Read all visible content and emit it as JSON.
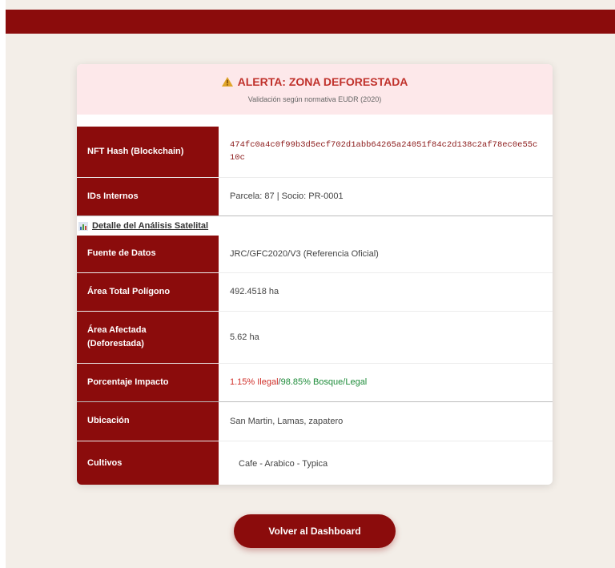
{
  "alert": {
    "title": "ALERTA: ZONA DEFORESTADA",
    "subtitle": "Validación según normativa EUDR (2020)"
  },
  "nft": {
    "label": "NFT Hash (Blockchain)",
    "value": "474fc0a4c0f99b3d5ecf702d1abb64265a24051f84c2d138c2af78ec0e55c10c"
  },
  "internal": {
    "label": "IDs Internos",
    "value": "Parcela: 87 | Socio: PR-0001"
  },
  "section": {
    "title": "Detalle del Análisis Satelital"
  },
  "details": {
    "source": {
      "label": "Fuente de Datos",
      "value": "JRC/GFC2020/V3 (Referencia Oficial)"
    },
    "area_total": {
      "label": "Área Total Polígono",
      "value": "492.4518 ha"
    },
    "area_affected": {
      "label_line1": "Área Afectada",
      "label_line2": "(Deforestada)",
      "value": "5.62 ha"
    },
    "impact": {
      "label": "Porcentaje Impacto",
      "illegal": "1.15% Ilegal",
      "legal": "98.85% Bosque/Legal",
      "separator": "/"
    },
    "location": {
      "label": "Ubicación",
      "value": "San Martin, Lamas, zapatero"
    },
    "crops": {
      "label": "Cultivos",
      "value": "Cafe - Arabico - Typica"
    }
  },
  "button": {
    "label": "Volver al Dashboard"
  },
  "colors": {
    "brand": "#8b0c0c",
    "alert_bg": "#fde8ea",
    "alert_text": "#c0312b",
    "illegal": "#d0302a",
    "legal": "#1e8c3a"
  }
}
